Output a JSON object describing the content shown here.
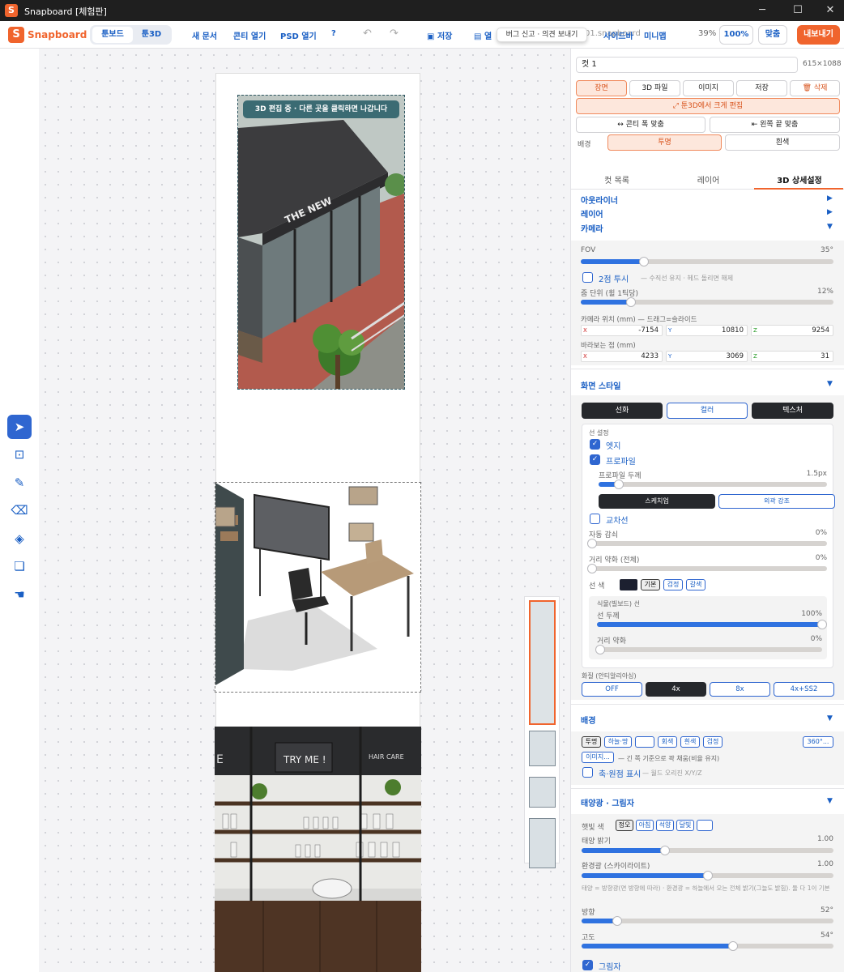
{
  "window": {
    "title": "Snapboard  [체험판]",
    "controls": [
      "─",
      "☐",
      "✕"
    ]
  },
  "toolbar": {
    "logo": "Snapboard",
    "modes": [
      "툰보드",
      "툰3D"
    ],
    "new_doc": "새 문서",
    "open_cut": "콘티 열기",
    "open_psd": "PSD 열기",
    "help": "?",
    "save": "저장",
    "open_prefix": "열",
    "filename": "01.snapboard",
    "sidebar_toggle": "사이드바",
    "minimap": "미니맵",
    "zoom": "39%",
    "zoom_100": "100%",
    "fit": "맞춤",
    "export": "내보내기",
    "tooltip": "버그 신고 · 의견 보내기"
  },
  "canvas": {
    "hint": "3D 편집 중 · 다른 곳을 클릭하면 나갑니다",
    "store_sign": "THE NEW",
    "shop_sign_1": "TRY ME !",
    "shop_sign_2": "HAIR CARE",
    "shop_sign_3": "E"
  },
  "panel": {
    "cut_name": "컷 1",
    "cut_size": "615×1088",
    "row1": [
      "장면",
      "3D 파일",
      "이미지",
      "저장",
      "삭제"
    ],
    "edit_big": "툰3D에서 크게 편집",
    "fit_width": "콘티 폭 맞춤",
    "fit_left": "왼쪽 끝 맞춤",
    "bg_label": "배경",
    "bg_opts": [
      "투명",
      "흰색"
    ],
    "tabs": [
      "컷 목록",
      "레이어",
      "3D 상세설정"
    ],
    "sections": {
      "outliner": "아웃라이너",
      "layer": "레이어",
      "camera": "카메라"
    },
    "camera": {
      "fov_label": "FOV",
      "fov_value": "35°",
      "fov": 0.25,
      "two_point": "2점 투시",
      "two_point_hint": "— 수직선 유지 · 헤드 돌리면 해제",
      "zoom_step_label": "줌 단위 (휠 1틱당)",
      "zoom_step_value": "12%",
      "zoom_step": 0.2,
      "pos_label": "카메라 위치 (mm) — 드래그=슬라이드",
      "pos": {
        "x": "-7154",
        "y": "10810",
        "z": "9254"
      },
      "target_label": "바라보는 점 (mm)",
      "target": {
        "x": "4233",
        "y": "3069",
        "z": "31"
      },
      "axes": [
        "X",
        "Y",
        "Z"
      ]
    },
    "style": {
      "title": "화면 스타일",
      "modes": [
        "선화",
        "컬러",
        "텍스처"
      ],
      "line_settings": "선 설정",
      "edge": "엣지",
      "profile": "프로파일",
      "profile_width_label": "프로파일 두께",
      "profile_width_value": "1.5px",
      "profile_width": 0.09,
      "sketch": "스케치업",
      "outline": "외곽 강조",
      "intersect": "교차선",
      "auto_thin_label": "자동 감쇠",
      "auto_thin_value": "0%",
      "dist_fade_label": "거리 약화 (전체)",
      "dist_fade_value": "0%",
      "line_color_label": "선 색",
      "line_color_opts": [
        "기본",
        "검정",
        "갈색"
      ],
      "plant_label": "식물(빌보드) 선",
      "line_width_label": "선 두께",
      "line_width_value": "100%",
      "line_width": 1.0,
      "plant_fade_label": "거리 약화",
      "plant_fade_value": "0%",
      "aa_label": "화질 (안티알리아싱)",
      "aa_opts": [
        "OFF",
        "4x",
        "8x",
        "4x+SS2"
      ]
    },
    "background": {
      "title": "배경",
      "opts": [
        "투명",
        "하늘·땅",
        "",
        "회색",
        "흰색",
        "검정"
      ],
      "sky360": "360°...",
      "image": "이미지...",
      "image_hint": "— 긴 쪽 기준으로 꽉 채움(비율 유지)",
      "axes_origin": "축·원점 표시",
      "axes_hint": "— 월드 오리진 X/Y/Z"
    },
    "sun": {
      "title": "태양광 · 그림자",
      "color_label": "햇빛 색",
      "color_opts": [
        "정오",
        "아침",
        "석양",
        "달빛",
        ""
      ],
      "sun_brightness_label": "태양 밝기",
      "sun_brightness_value": "1.00",
      "sun_brightness": 0.33,
      "ambient_label": "환경광 (스카이라이트)",
      "ambient_value": "1.00",
      "ambient": 0.5,
      "note": "태양 = 방향광(면 방향에 따라) · 환경광 = 하늘에서 오는 전체 밝기(그늘도 밝힘). 둘 다 1이 기본",
      "direction_label": "방향",
      "direction_value": "52°",
      "direction": 0.14,
      "altitude_label": "고도",
      "altitude_value": "54°",
      "altitude": 0.6,
      "shadow": "그림자"
    }
  },
  "colors": {
    "accent": "#f0642d",
    "blue": "#1a5fc4",
    "slider": "#2f72e0"
  }
}
